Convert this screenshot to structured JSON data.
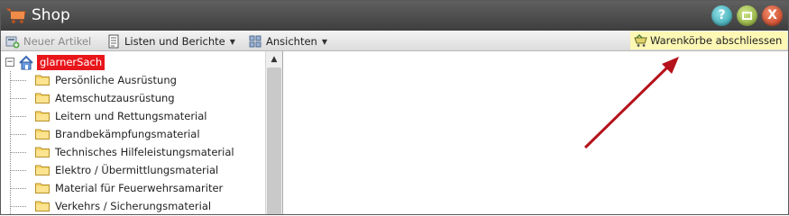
{
  "window": {
    "title": "Shop",
    "icon": "shopping-cart-icon",
    "controls": {
      "help": "?",
      "maximize": "maximize-icon",
      "close": "X"
    }
  },
  "toolbar": {
    "new_article": "Neuer Artikel",
    "lists_reports": "Listen und Berichte",
    "views": "Ansichten",
    "close_carts": "Warenkörbe abschliessen"
  },
  "tree": {
    "root": "glarnerSach",
    "items": [
      {
        "label": "Persönliche Ausrüstung"
      },
      {
        "label": "Atemschutzausrüstung"
      },
      {
        "label": "Leitern und Rettungsmaterial"
      },
      {
        "label": "Brandbekämpfungsmaterial"
      },
      {
        "label": "Technisches Hilfeleistungsmaterial"
      },
      {
        "label": "Elektro / Übermittlungsmaterial"
      },
      {
        "label": "Material für Feuerwehrsamariter"
      },
      {
        "label": "Verkehrs / Sicherungsmaterial"
      }
    ]
  },
  "colors": {
    "titlebar": "#4e4e4e",
    "root_highlight": "#e8161a",
    "button_highlight": "#fdf8b4",
    "annotation_arrow": "#b5121b"
  }
}
